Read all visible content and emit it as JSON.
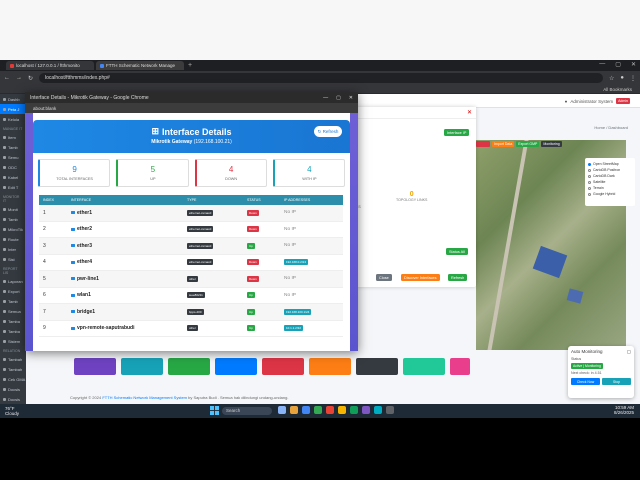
{
  "browser": {
    "tabs": [
      {
        "label": "localhost / 127.0.0.1 / ftthmonito"
      },
      {
        "label": "FTTH Schematic Network Manage"
      }
    ],
    "address": "localhost/ftthmms/index.php#",
    "bookmarks_label": "All Bookmarks"
  },
  "app": {
    "user_label": "Administrator System",
    "user_role": "Admin",
    "breadcrumb": "Home / Dashboard",
    "sidebar": [
      "Dashb",
      "Peta J",
      "Kelola",
      "MANAGE IT",
      "Item",
      "Tamb",
      "Semu",
      "ODC",
      "Kabel",
      "Edit T",
      "MONITOR IT",
      "Monit",
      "Tamb",
      "MikroTik",
      "Route",
      "Inter",
      "Sist",
      "REPORT LIS",
      "Laporan",
      "Export",
      "Tamb",
      "Semua",
      "Tamba",
      "Tamba",
      "Sistem",
      "RELATION",
      "Tambah",
      "Tambah",
      "Cek GMA",
      "Docsis",
      "Docsis"
    ],
    "map_buttons": [
      "",
      "Import Data",
      "Export GMP",
      "Monitoring"
    ],
    "map_layers": [
      "Open StreetMap",
      "CartoDB Positron",
      "CartoDB Dark",
      "Satellite",
      "Terrain",
      "Google Hybrid"
    ],
    "footer_prefix": "Copyright © 2024",
    "footer_brand": "FTTH Schematic Network Management System",
    "footer_suffix": "by Saputra Budi . Semua hak dilindungi undang-undang."
  },
  "bg_modal": {
    "interfaces_button": "Interface IP",
    "stat_value": "0",
    "stat_label": "TOPOLOGY LINKS",
    "side_label": "ES",
    "status_button": "Status All",
    "close_button": "Close",
    "discover_button": "Discover Interfaces",
    "refresh_button": "Refresh"
  },
  "monitor": {
    "title": "Auto Monitoring",
    "status_label": "Status",
    "status_value": "Active | Monitoring",
    "next_check": "Next check: in 4.51",
    "btn1": "Check Now",
    "btn2": "Stop"
  },
  "popup": {
    "window_title": "Interface Details - Mikrotik Gateway - Google Chrome",
    "url": "about:blank",
    "title": "Interface Details",
    "subtitle_device": "Mikrotik Gateway",
    "subtitle_ip": "(192.168.100.21)",
    "refresh": "Refresh",
    "stats": [
      {
        "value": "9",
        "label": "TOTAL INTERFACES",
        "color": "#1e88e5"
      },
      {
        "value": "5",
        "label": "UP",
        "color": "#28a745"
      },
      {
        "value": "4",
        "label": "DOWN",
        "color": "#dc3545"
      },
      {
        "value": "4",
        "label": "WITH IP",
        "color": "#17a2b8"
      }
    ],
    "columns": [
      "INDEX",
      "INTERFACE",
      "TYPE",
      "STATUS",
      "IP ADDRESSES"
    ],
    "rows": [
      {
        "index": "1",
        "name": "ether1",
        "type": "ethernet-csmacd",
        "status": "Down",
        "status_color": "#dc3545",
        "ip": "No IP",
        "has_ip": false
      },
      {
        "index": "2",
        "name": "ether2",
        "type": "ethernet-csmacd",
        "status": "Down",
        "status_color": "#dc3545",
        "ip": "No IP",
        "has_ip": false
      },
      {
        "index": "3",
        "name": "ether3",
        "type": "ethernet-csmacd",
        "status": "Up",
        "status_color": "#28a745",
        "ip": "No IP",
        "has_ip": false
      },
      {
        "index": "4",
        "name": "ether4",
        "type": "ethernet-csmacd",
        "status": "Down",
        "status_color": "#dc3545",
        "ip": "192.168.0.2/24",
        "has_ip": true
      },
      {
        "index": "5",
        "name": "pwr-line1",
        "type": "other",
        "status": "Down",
        "status_color": "#dc3545",
        "ip": "No IP",
        "has_ip": false
      },
      {
        "index": "6",
        "name": "wlan1",
        "type": "ieee80211",
        "status": "Up",
        "status_color": "#28a745",
        "ip": "No IP",
        "has_ip": false
      },
      {
        "index": "7",
        "name": "bridge1",
        "type": "bpps-200",
        "status": "Up",
        "status_color": "#28a745",
        "ip": "192.168.100.1/24",
        "has_ip": true
      },
      {
        "index": "9",
        "name": "vpn-remote-saputrabudi",
        "type": "other",
        "status": "Up",
        "status_color": "#28a745",
        "ip": "10.1.1.2/32",
        "has_ip": true
      }
    ]
  },
  "taskbar": {
    "weather_temp": "76°F",
    "weather_desc": "Cloudy",
    "search": "Search",
    "time": "10:59 AM",
    "date": "8/26/2025"
  }
}
